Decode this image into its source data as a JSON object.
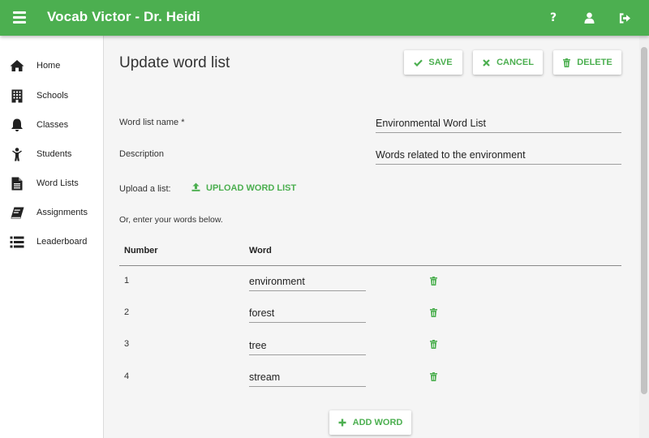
{
  "app": {
    "title": "Vocab Victor - Dr. Heidi"
  },
  "topbar": {
    "icons": [
      "menu-icon",
      "help-icon",
      "user-icon",
      "logout-icon"
    ]
  },
  "sidebar": {
    "items": [
      {
        "label": "Home",
        "icon": "home-icon"
      },
      {
        "label": "Schools",
        "icon": "building-icon"
      },
      {
        "label": "Classes",
        "icon": "bell-icon"
      },
      {
        "label": "Students",
        "icon": "child-icon"
      },
      {
        "label": "Word Lists",
        "icon": "document-icon"
      },
      {
        "label": "Assignments",
        "icon": "book-icon"
      },
      {
        "label": "Leaderboard",
        "icon": "list-icon"
      }
    ]
  },
  "page": {
    "title": "Update word list",
    "buttons": {
      "save": "SAVE",
      "cancel": "CANCEL",
      "delete": "DELETE"
    }
  },
  "form": {
    "name_label": "Word list name *",
    "name_value": "Environmental Word List",
    "description_label": "Description",
    "description_value": "Words related to the environment",
    "upload_label": "Upload a list:",
    "upload_button": "UPLOAD WORD LIST",
    "or_text": "Or, enter your words below."
  },
  "table": {
    "headers": {
      "number": "Number",
      "word": "Word"
    },
    "rows": [
      {
        "number": "1",
        "word": "environment"
      },
      {
        "number": "2",
        "word": "forest"
      },
      {
        "number": "3",
        "word": "tree"
      },
      {
        "number": "4",
        "word": "stream"
      }
    ]
  },
  "add_word_button": "ADD WORD",
  "colors": {
    "accent": "#4caf50",
    "background": "#f5f5f5",
    "sidebar": "#ffffff"
  }
}
